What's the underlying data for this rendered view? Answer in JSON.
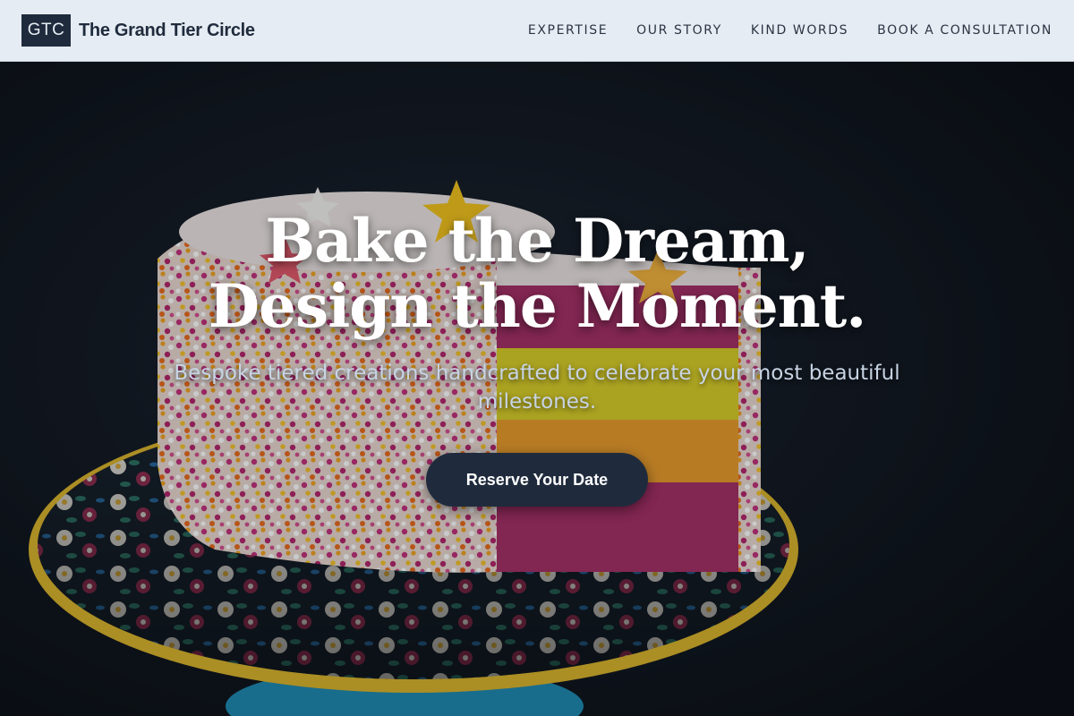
{
  "brand": {
    "logo": "GTC",
    "name": "The Grand Tier Circle"
  },
  "nav": {
    "items": [
      {
        "label": "EXPERTISE"
      },
      {
        "label": "OUR STORY"
      },
      {
        "label": "KIND WORDS"
      },
      {
        "label": "BOOK A CONSULTATION"
      }
    ]
  },
  "hero": {
    "title_line1": "Bake the Dream,",
    "title_line2": "Design the Moment.",
    "subtitle": "Bespoke tiered creations handcrafted to celebrate your most beautiful milestones.",
    "cta_label": "Reserve Your Date",
    "image": "rainbow-layer-cake-with-sprinkles-on-floral-cake-stand"
  },
  "colors": {
    "header_bg": "#e6ecf3",
    "brand_navy": "#1f2b3d",
    "hero_bg": "#0d1117",
    "title_text": "#ffffff",
    "subtitle_text": "#c8d4e4"
  }
}
